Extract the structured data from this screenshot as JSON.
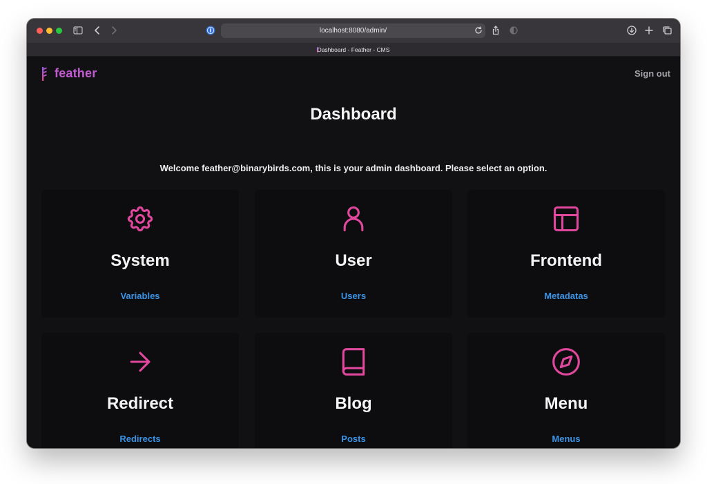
{
  "browser": {
    "url": "localhost:8080/admin/",
    "tab_title": "Dashboard - Feather - CMS"
  },
  "colors": {
    "accent": "#e0489e",
    "link": "#3b93e6",
    "logo": "#c35ad4",
    "background": "#111113"
  },
  "header": {
    "logo_text": "feather",
    "sign_out": "Sign out"
  },
  "main": {
    "title": "Dashboard",
    "welcome_prefix": "Welcome ",
    "welcome_email": "feather@binarybirds.com",
    "welcome_suffix": ", this is your admin dashboard. Please select an option."
  },
  "modules": [
    {
      "title": "System",
      "link": "Variables",
      "icon": "gear-icon"
    },
    {
      "title": "User",
      "link": "Users",
      "icon": "user-icon"
    },
    {
      "title": "Frontend",
      "link": "Metadatas",
      "icon": "layout-icon"
    },
    {
      "title": "Redirect",
      "link": "Redirects",
      "icon": "arrow-right-icon"
    },
    {
      "title": "Blog",
      "link": "Posts",
      "icon": "book-icon"
    },
    {
      "title": "Menu",
      "link": "Menus",
      "icon": "compass-icon"
    }
  ]
}
